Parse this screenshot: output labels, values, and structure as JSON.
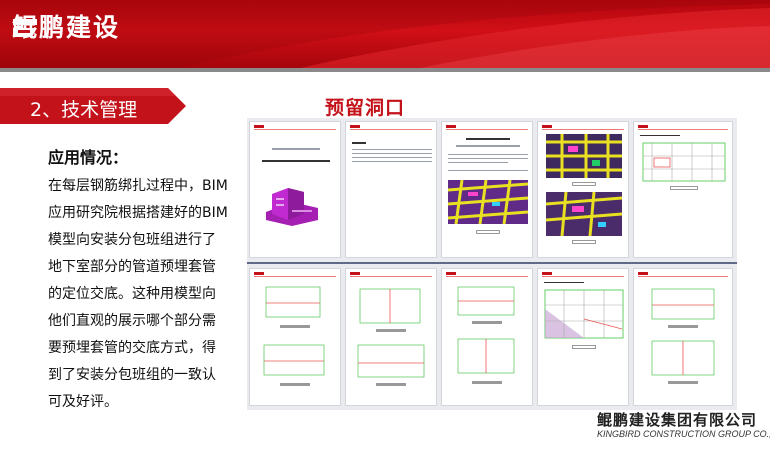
{
  "header": {
    "brand": "鲲鹏建设"
  },
  "section": {
    "title": "2、技术管理",
    "reserve_title": "预留洞口"
  },
  "content": {
    "heading": "应用情况：",
    "lines": [
      "在每层钢筋绑扎过程中，BIM",
      "应用研究院根据搭建好的BIM",
      "模型向安装分包班组进行了",
      "地下室部分的管道预埋套管",
      "的定位交底。这种用模型向",
      "他们直观的展示哪个部分需",
      "要预埋套管的交底方式，得",
      "到了安装分包班组的一致认",
      "可及好评。"
    ]
  },
  "footer": {
    "company_cn": "鲲鹏建设集团有限公司",
    "company_en": "KINGBIRD CONSTRUCTION GROUP CO.,LTD"
  },
  "colors": {
    "brand_red": "#c4121a",
    "banner_red": "#d10f17",
    "panel_bg": "#e9ebef"
  },
  "icons": {
    "logo": "kingbird-logo-icon"
  }
}
